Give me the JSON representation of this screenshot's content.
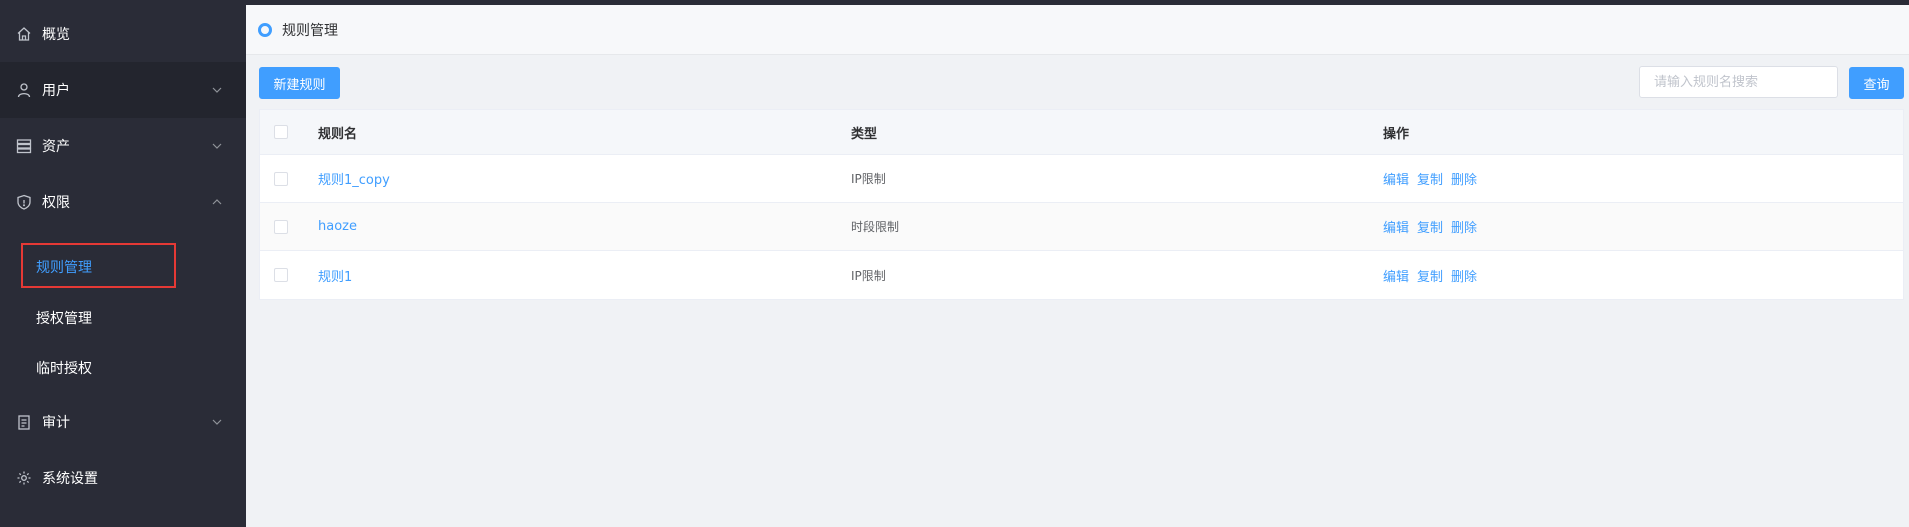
{
  "colors": {
    "sidebar_bg": "#2a2c37",
    "accent": "#409eff",
    "highlight": "#e53935"
  },
  "sidebar": {
    "items": [
      {
        "label": "概览",
        "icon": "home-icon"
      },
      {
        "label": "用户",
        "icon": "user-icon",
        "expandable": true
      },
      {
        "label": "资产",
        "icon": "server-icon",
        "expandable": true
      },
      {
        "label": "权限",
        "icon": "shield-icon",
        "expandable": true,
        "expanded": true
      },
      {
        "label": "审计",
        "icon": "clipboard-icon",
        "expandable": true
      },
      {
        "label": "系统设置",
        "icon": "gear-icon"
      }
    ],
    "sub_items": [
      {
        "label": "规则管理",
        "active": true
      },
      {
        "label": "授权管理"
      },
      {
        "label": "临时授权"
      }
    ]
  },
  "header": {
    "title": "规则管理"
  },
  "toolbar": {
    "new_label": "新建规则",
    "search_placeholder": "请输入规则名搜索",
    "query_label": "查询"
  },
  "table": {
    "columns": [
      "规则名",
      "类型",
      "操作"
    ],
    "rows": [
      {
        "name": "规则1_copy",
        "type": "IP限制"
      },
      {
        "name": "haoze",
        "type": "时段限制"
      },
      {
        "name": "规则1",
        "type": "IP限制"
      }
    ],
    "actions": [
      "编辑",
      "复制",
      "删除"
    ]
  }
}
